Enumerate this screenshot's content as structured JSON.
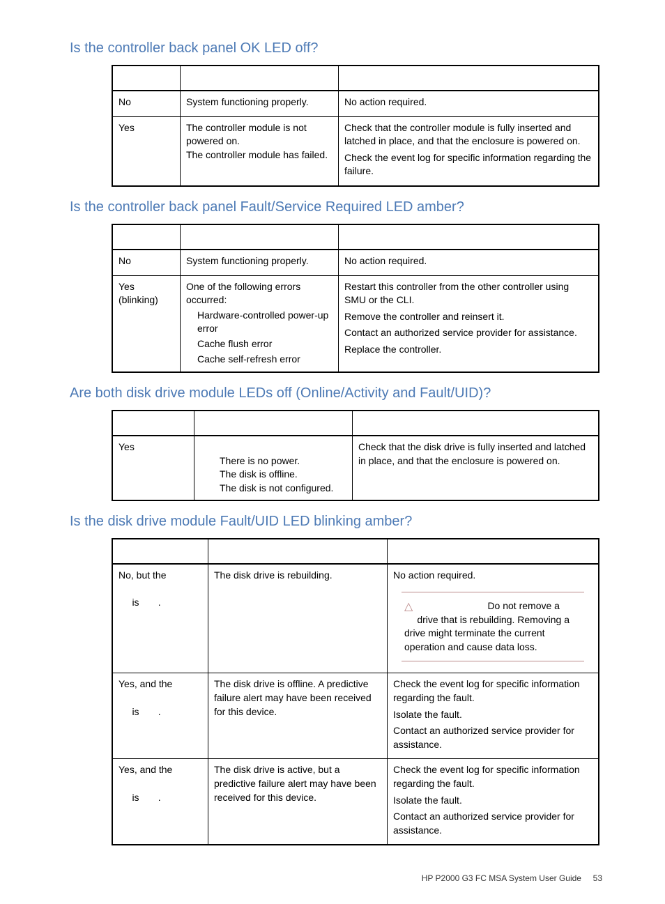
{
  "sections": [
    {
      "heading": "Is the controller back panel OK LED off?",
      "tableClass": "t1",
      "rows": [
        {
          "answer": "No",
          "meaning": [
            "System functioning properly."
          ],
          "action": [
            "No action required."
          ]
        },
        {
          "answer": "Yes",
          "meaning": [
            "The controller module is not powered on.",
            "The controller module has failed."
          ],
          "action": [
            "Check that the controller module is fully inserted and latched in place, and that the enclosure is powered on.",
            "Check the event log for specific information regarding the failure."
          ]
        }
      ]
    },
    {
      "heading": "Is the controller back panel Fault/Service Required LED amber?",
      "tableClass": "t1",
      "rows": [
        {
          "answer": "No",
          "meaning": [
            "System functioning properly."
          ],
          "action": [
            "No action required."
          ]
        },
        {
          "answer": "Yes (blinking)",
          "meaning": [
            "One of the following errors occurred:"
          ],
          "sublist": [
            "Hardware-controlled power-up error",
            "Cache flush error",
            "Cache self-refresh error"
          ],
          "action": [
            "Restart this controller from the other controller using SMU or the CLI.",
            "Remove the controller and reinsert it.",
            "Contact an authorized service provider for assistance.",
            "Replace the controller."
          ]
        }
      ]
    },
    {
      "heading": "Are both disk drive module LEDs off (Online/Activity and Fault/UID)?",
      "tableClass": "t3",
      "rows": [
        {
          "answer": "Yes",
          "meaning": [
            "",
            "There is no power.",
            "The disk is offline.",
            "The disk is not configured."
          ],
          "indentMeaning": true,
          "action": [
            "Check that the disk drive is fully inserted and latched in place, and that the enclosure is powered on."
          ]
        }
      ]
    },
    {
      "heading": "Is the disk drive module Fault/UID LED blinking amber?",
      "tableClass": "t4",
      "rows": [
        {
          "answerLines": [
            "No, but the",
            "",
            "     is       ."
          ],
          "meaning": [
            "The disk drive is rebuilding."
          ],
          "action": [
            "No action required."
          ],
          "caution": "                          Do not remove a drive that is rebuilding. Removing a drive might terminate the current operation and cause data loss."
        },
        {
          "answerLines": [
            "Yes, and the",
            "",
            "     is       ."
          ],
          "meaning": [
            "The disk drive is offline. A predictive failure alert may have been received for this device."
          ],
          "action": [
            "Check the event log for specific information regarding the fault.",
            "Isolate the fault.",
            "Contact an authorized service provider for assistance."
          ]
        },
        {
          "answerLines": [
            "Yes, and the",
            "",
            "     is       ."
          ],
          "meaning": [
            "The disk drive is active, but a predictive failure alert may have been received for this device."
          ],
          "action": [
            "Check the event log for specific information regarding the fault.",
            "Isolate the fault.",
            "Contact an authorized service provider for assistance."
          ]
        }
      ]
    }
  ],
  "footer": {
    "doc": "HP P2000 G3 FC MSA System User Guide",
    "page": "53"
  }
}
